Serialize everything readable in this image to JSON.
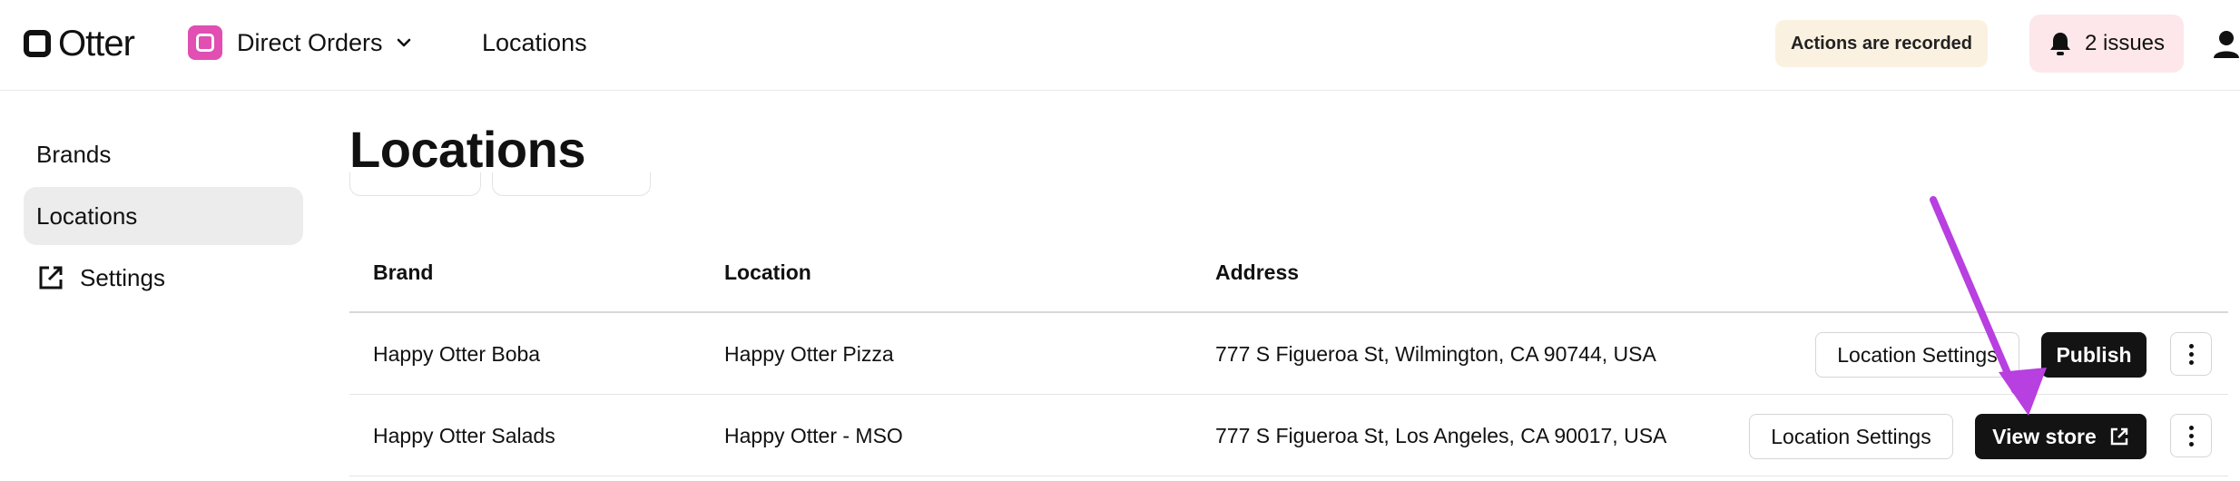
{
  "header": {
    "logo_text": "Otter",
    "app_name": "Direct Orders",
    "nav_current": "Locations",
    "recorded_notice": "Actions are recorded",
    "issues_label": "2 issues"
  },
  "sidebar": {
    "items": [
      {
        "label": "Brands",
        "icon": null
      },
      {
        "label": "Locations",
        "icon": null,
        "active": true
      },
      {
        "label": "Settings",
        "icon": "external-link-icon"
      }
    ]
  },
  "main": {
    "title": "Locations",
    "table": {
      "columns": [
        "Brand",
        "Location",
        "Address"
      ],
      "rows": [
        {
          "brand": "Happy Otter Boba",
          "location": "Happy Otter Pizza",
          "address": "777 S Figueroa St, Wilmington, CA 90744, USA",
          "secondary_action": "Location Settings",
          "primary_action": "Publish"
        },
        {
          "brand": "Happy Otter Salads",
          "location": "Happy Otter - MSO",
          "address": "777 S Figueroa St, Los Angeles, CA 90017, USA",
          "secondary_action": "Location Settings",
          "primary_action": "View store"
        }
      ]
    }
  },
  "colors": {
    "accent_app_icon": "#e04fb1",
    "recorded_bg": "#fbf1e1",
    "issues_bg": "#fde7ea",
    "annotation_arrow": "#b83fe0"
  }
}
